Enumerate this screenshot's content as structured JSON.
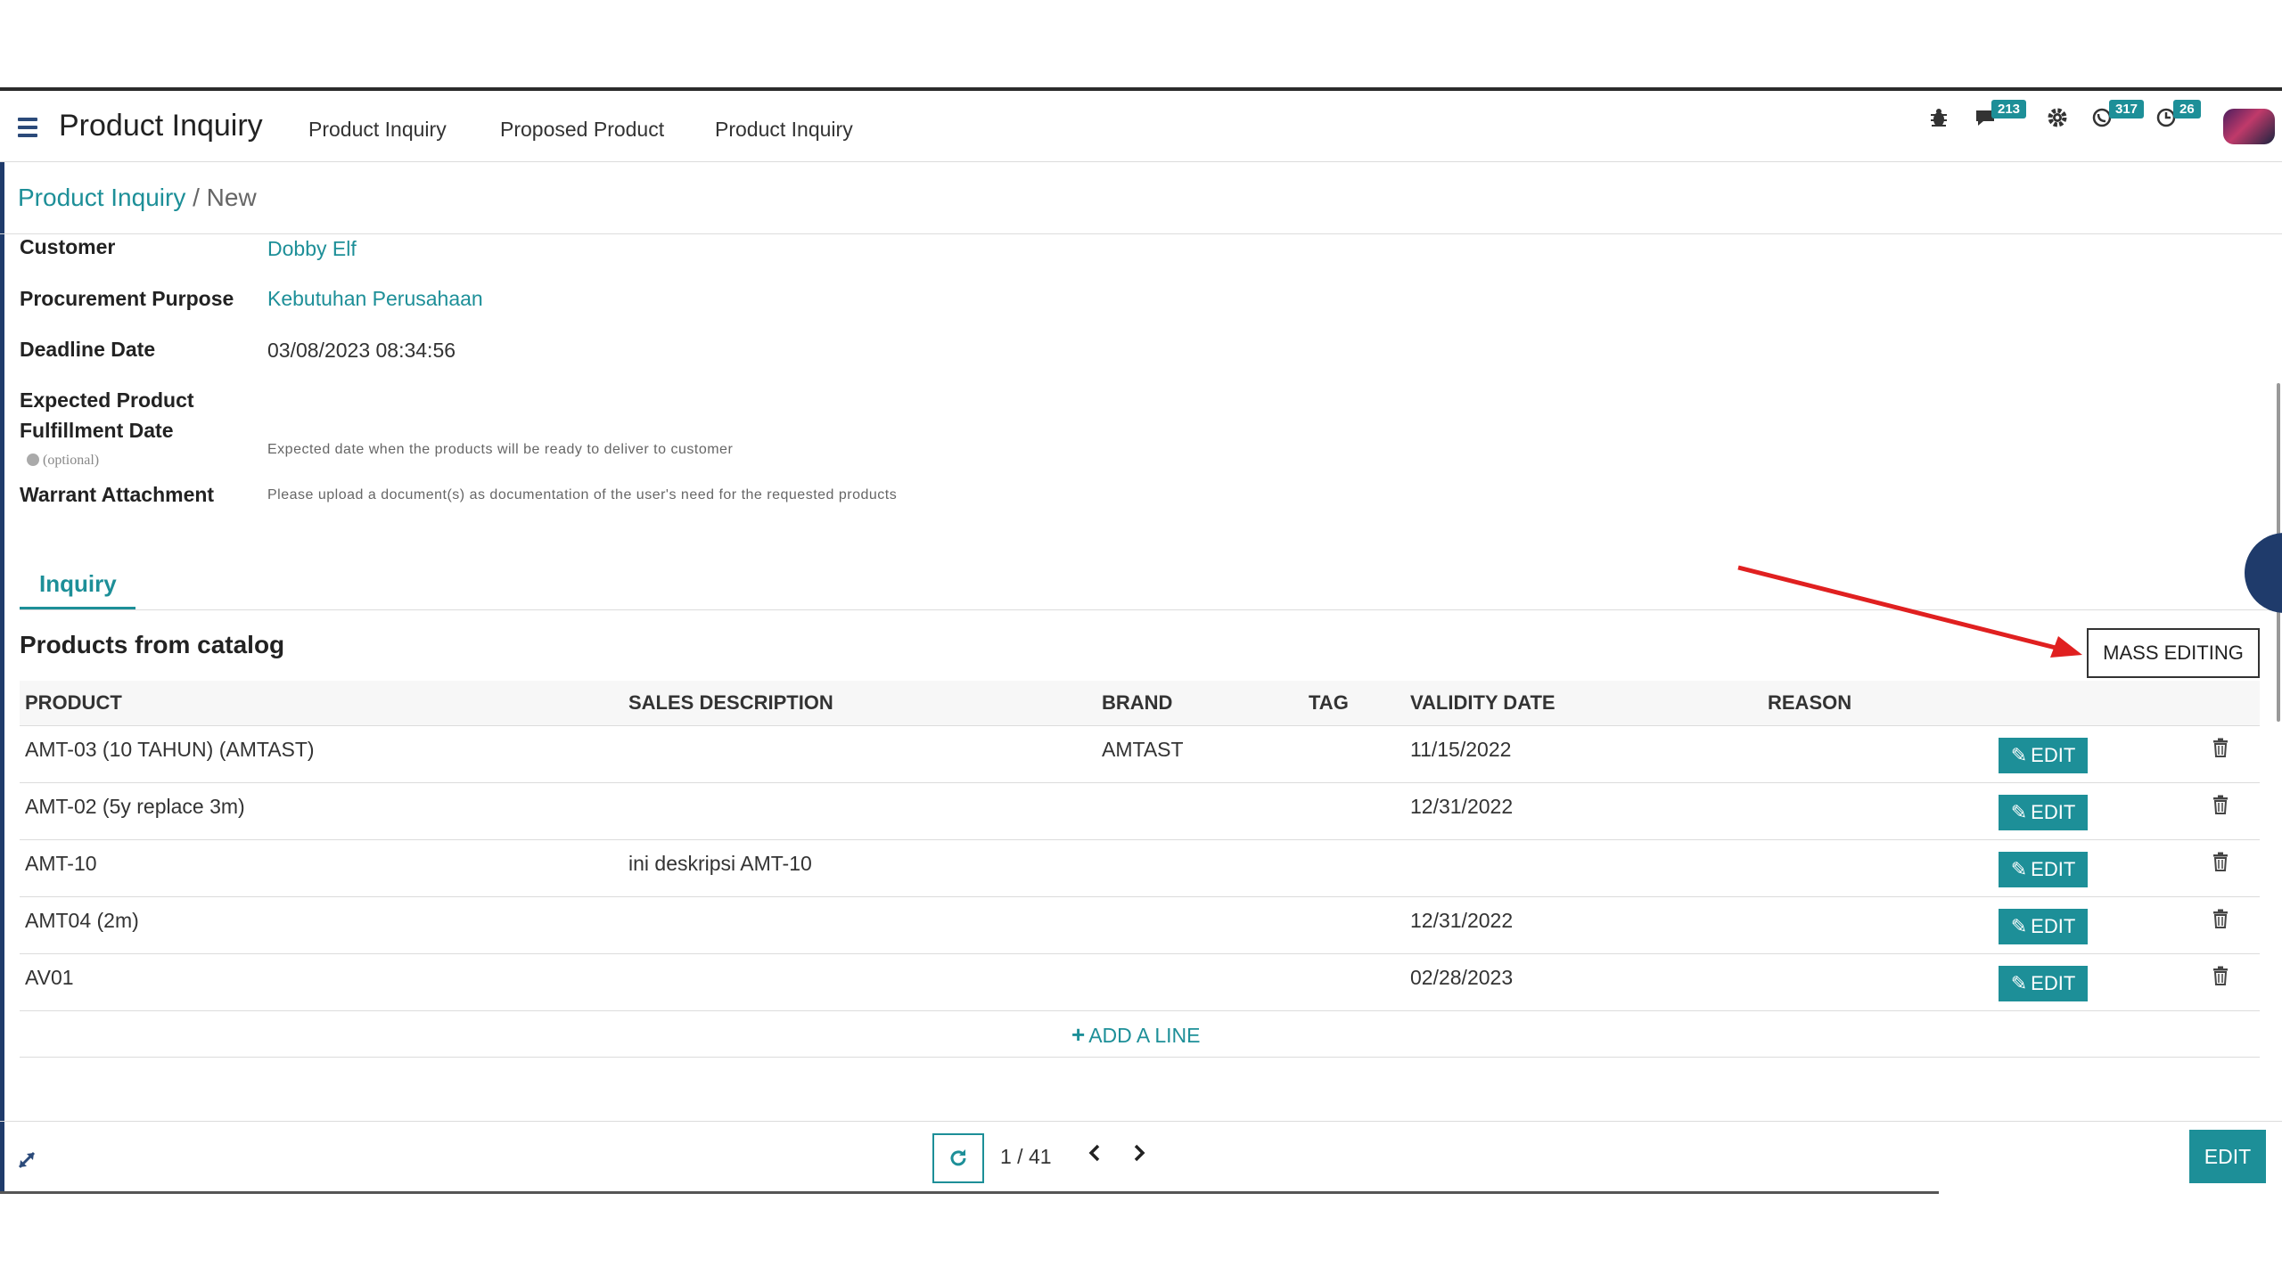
{
  "topbar": {
    "app_title": "Product Inquiry",
    "menu": [
      "Product Inquiry",
      "Proposed Product",
      "Product Inquiry"
    ],
    "icons": {
      "debug": "bug-icon",
      "messages": {
        "icon": "chat-icon",
        "badge": "213"
      },
      "settings": "gear-icon",
      "whatsapp": {
        "icon": "phone-chat-icon",
        "badge": "317"
      },
      "activities": {
        "icon": "clock-icon",
        "badge": "26"
      },
      "user": "avatar"
    }
  },
  "breadcrumb": {
    "parent": "Product Inquiry",
    "separator": "/",
    "current": "New"
  },
  "form": {
    "customer": {
      "label": "Customer",
      "value": "Dobby Elf"
    },
    "procurement_purpose": {
      "label": "Procurement Purpose",
      "value": "Kebutuhan Perusahaan"
    },
    "deadline_date": {
      "label": "Deadline Date",
      "value": "03/08/2023 08:34:56"
    },
    "expected_fulfillment": {
      "label_line1": "Expected Product",
      "label_line2": "Fulfillment Date",
      "optional": "(optional)",
      "help": "Expected date when the products will be ready to deliver to customer"
    },
    "warrant_attachment": {
      "label": "Warrant Attachment",
      "help": "Please upload a document(s) as documentation of the user's need for the requested products"
    }
  },
  "tabs": {
    "active": "Inquiry"
  },
  "section": {
    "title": "Products from catalog",
    "mass_editing": "MASS EDITING"
  },
  "table": {
    "headers": [
      "PRODUCT",
      "SALES DESCRIPTION",
      "BRAND",
      "TAG",
      "VALIDITY DATE",
      "REASON"
    ],
    "rows": [
      {
        "product": "AMT-03 (10 TAHUN) (AMTAST)",
        "description": "",
        "brand": "AMTAST",
        "tag": "",
        "validity": "11/15/2022",
        "reason": ""
      },
      {
        "product": "AMT-02 (5y replace 3m)",
        "description": "",
        "brand": "",
        "tag": "",
        "validity": "12/31/2022",
        "reason": ""
      },
      {
        "product": "AMT-10",
        "description": "ini deskripsi AMT-10",
        "brand": "",
        "tag": "",
        "validity": "",
        "reason": ""
      },
      {
        "product": "AMT04 (2m)",
        "description": "",
        "brand": "",
        "tag": "",
        "validity": "12/31/2022",
        "reason": ""
      },
      {
        "product": "AV01",
        "description": "",
        "brand": "",
        "tag": "",
        "validity": "02/28/2023",
        "reason": ""
      }
    ],
    "row_edit_label": "EDIT",
    "add_line": "ADD A LINE"
  },
  "bottombar": {
    "pager": "1 / 41",
    "edit_label": "EDIT"
  },
  "colors": {
    "accent": "#1d8f98",
    "nav_dark": "#1f3b6b",
    "arrow": "#e02020"
  }
}
